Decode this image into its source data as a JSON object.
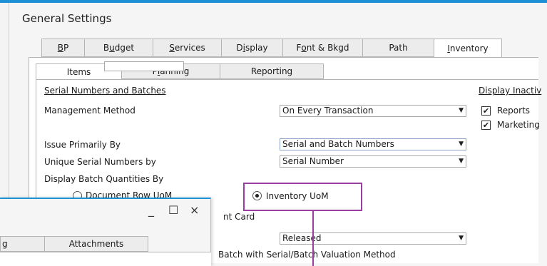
{
  "window": {
    "title": "General Settings"
  },
  "outer_tabs": [
    {
      "label": "BP",
      "accel": "B",
      "rest": "P"
    },
    {
      "label": "Budget",
      "accel": "u",
      "pre": "B",
      "rest": "dget"
    },
    {
      "label": "Services",
      "accel": "S",
      "rest": "ervices"
    },
    {
      "label": "Display",
      "accel": "i",
      "pre": "D",
      "rest": "splay"
    },
    {
      "label": "Font & Bkgd",
      "accel": "o",
      "pre": "F",
      "rest": "nt & Bkgd"
    },
    {
      "label": "Path"
    },
    {
      "label": "Inventory",
      "accel": "I",
      "rest": "nventory"
    }
  ],
  "inner_tabs": [
    {
      "label": "Items"
    },
    {
      "label": "Planning",
      "accel": "l",
      "pre": "P",
      "rest": "anning"
    },
    {
      "label": "Reporting"
    }
  ],
  "items": {
    "serial_heading": "Serial Numbers and Batches",
    "management_method_label": "Management Method",
    "management_method_value": "On Every Transaction",
    "issue_primarily_label": "Issue Primarily By",
    "issue_primarily_value": "Serial and Batch Numbers",
    "unique_serial_label": "Unique Serial Numbers by",
    "unique_serial_value": "Serial Number",
    "display_batch_label": "Display Batch Quantities By",
    "document_row_uom": "Document Row UoM",
    "inventory_uom": "Inventory UoM",
    "nt_card_fragment": "nt Card",
    "released_value": "Released",
    "batch_valuation_fragment": "Batch with Serial/Batch Valuation Method"
  },
  "display_inactive": {
    "heading": "Display Inactiv",
    "reports_label": "Reports",
    "marketing_label": "Marketing",
    "reports_checked": true,
    "marketing_checked": true
  },
  "sub_window": {
    "minimize": "_",
    "maximize": "☐",
    "close": "×",
    "tab_fragment": "g",
    "attachments_tab": "Attachments"
  },
  "colors": {
    "accent": "#1e90d6",
    "callout": "#9b3ea1"
  }
}
